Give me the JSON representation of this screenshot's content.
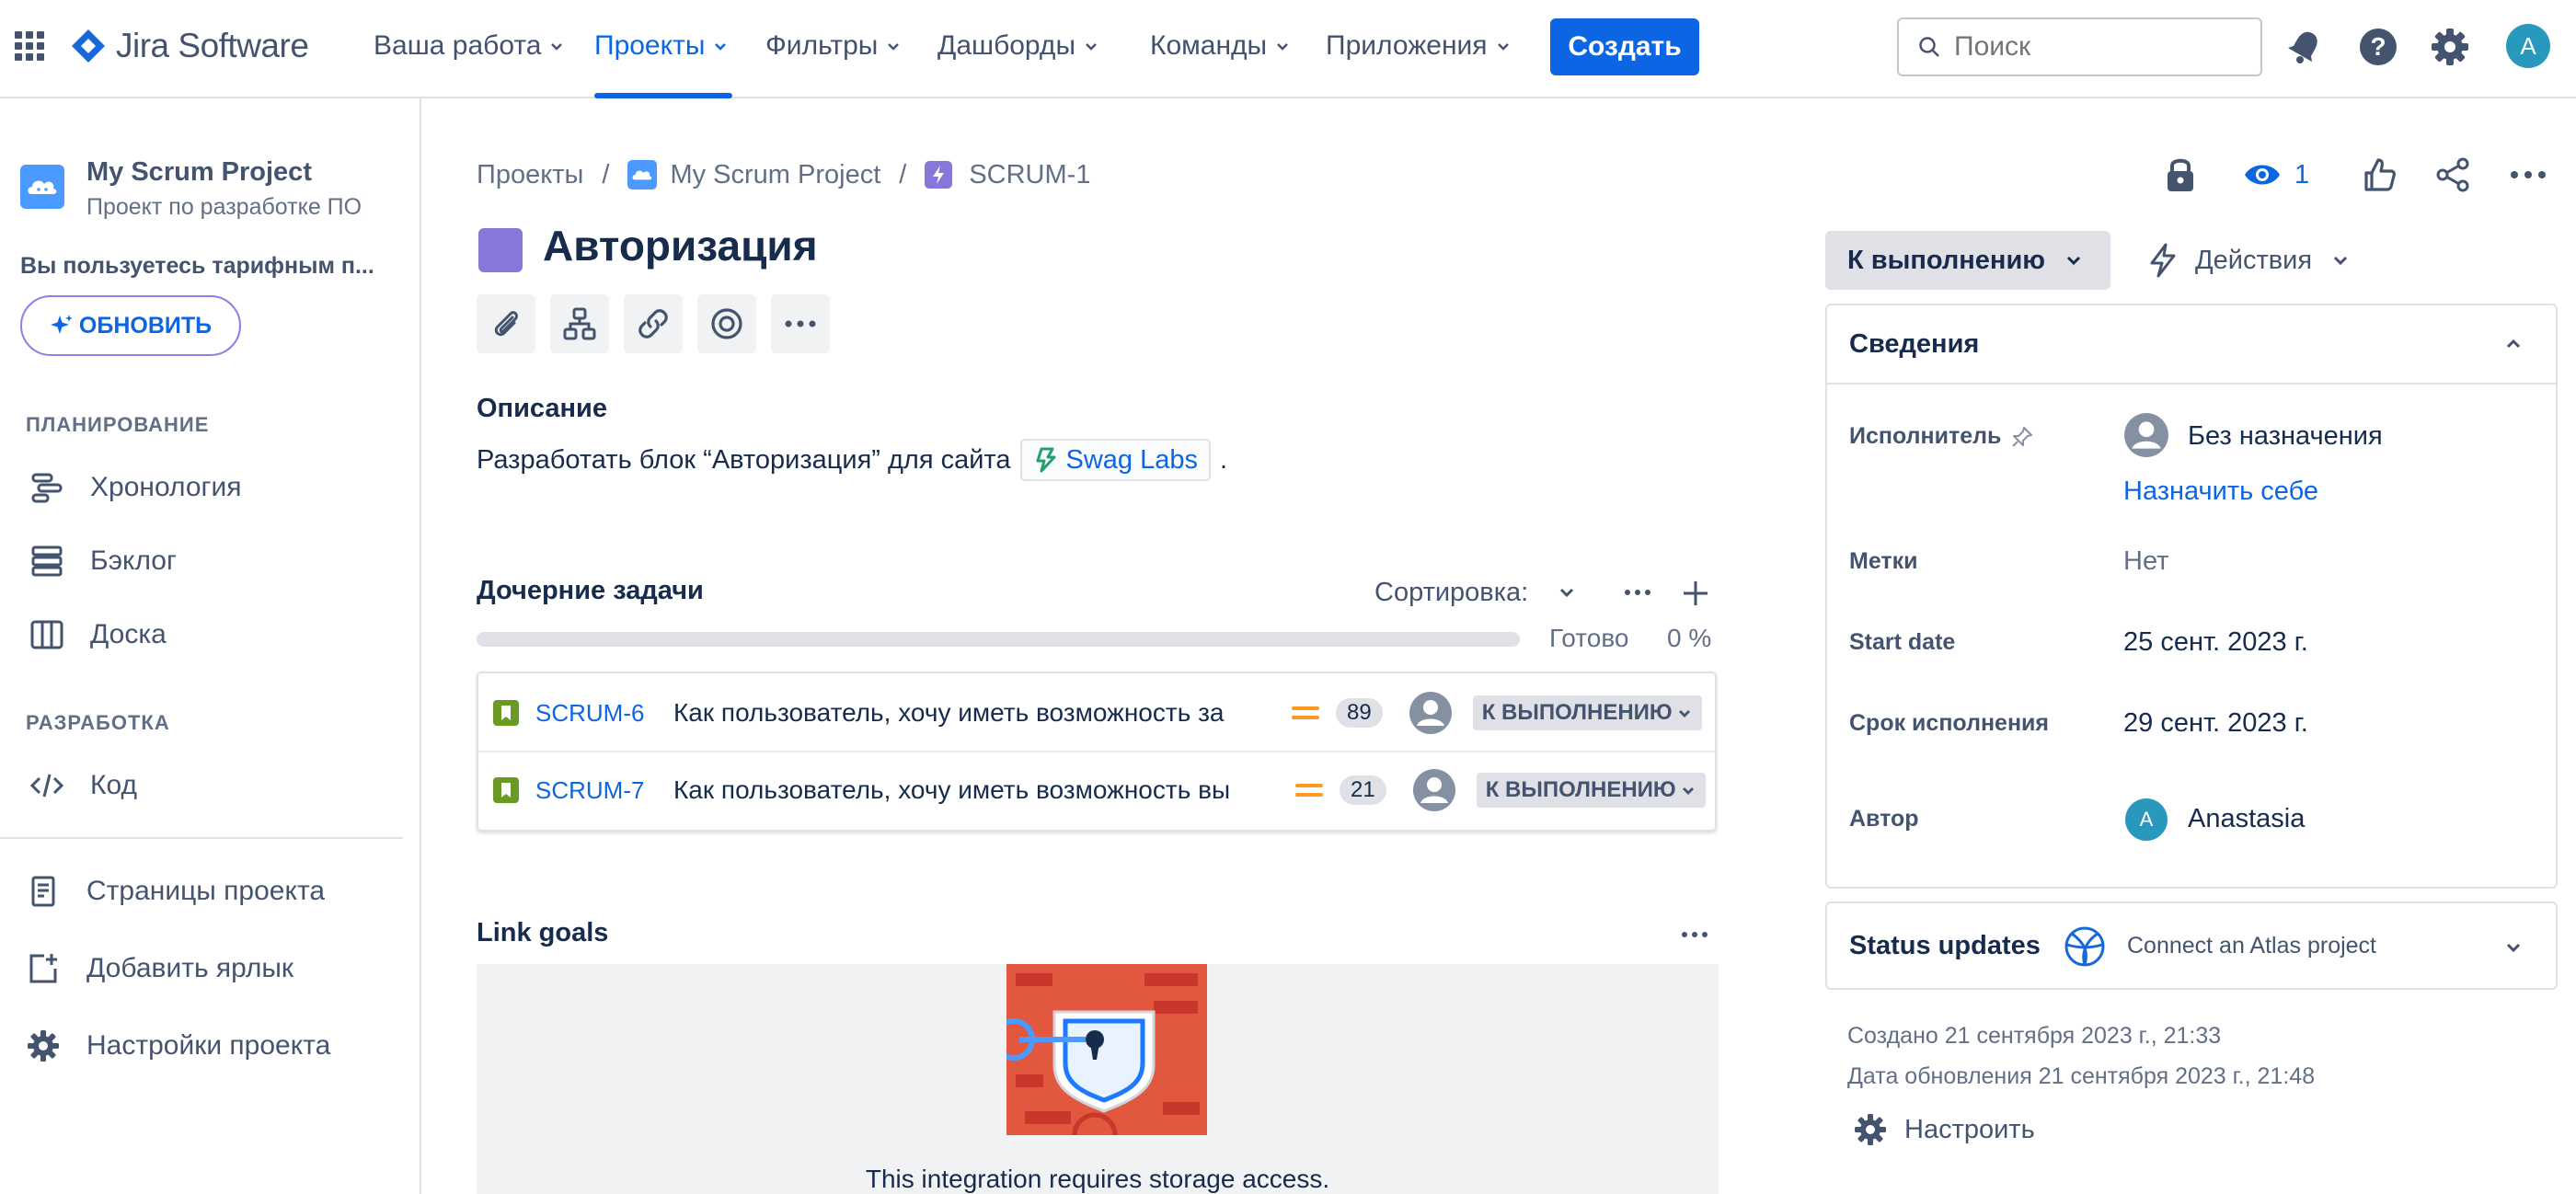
{
  "nav": {
    "product": "Jira Software",
    "items": [
      "Ваша работа",
      "Проекты",
      "Фильтры",
      "Дашборды",
      "Команды",
      "Приложения"
    ],
    "create": "Создать",
    "search_placeholder": "Поиск",
    "avatar": "A"
  },
  "sidebar": {
    "project_name": "My Scrum Project",
    "project_sub": "Проект по разработке ПО",
    "plan_note": "Вы пользуетесь тарифным п...",
    "upgrade": "ОБНОВИТЬ",
    "planning_heading": "ПЛАНИРОВАНИЕ",
    "planning": [
      "Хронология",
      "Бэклог",
      "Доска"
    ],
    "dev_heading": "РАЗРАБОТКА",
    "dev": [
      "Код"
    ],
    "bottom": [
      "Страницы проекта",
      "Добавить ярлык",
      "Настройки проекта"
    ]
  },
  "breadcrumb": {
    "projects": "Проекты",
    "project": "My Scrum Project",
    "issue": "SCRUM-1",
    "sep": "/"
  },
  "issue": {
    "title": "Авторизация",
    "description_label": "Описание",
    "description_text": "Разработать блок “Авторизация” для сайта",
    "link_text": "Swag Labs",
    "description_end": ".",
    "watchers": "1"
  },
  "children": {
    "title": "Дочерние задачи",
    "sort": "Сортировка:",
    "done_label": "Готово",
    "done_percent": "0 %",
    "progress": 0,
    "rows": [
      {
        "key": "SCRUM-6",
        "summary": "Как пользователь, хочу иметь возможность за",
        "points": "89",
        "status": "К ВЫПОЛНЕНИЮ"
      },
      {
        "key": "SCRUM-7",
        "summary": "Как пользователь, хочу иметь возможность вы",
        "points": "21",
        "status": "К ВЫПОЛНЕНИЮ"
      }
    ]
  },
  "goals": {
    "title": "Link goals",
    "message": "This integration requires storage access."
  },
  "panel": {
    "status_button": "К выполнению",
    "actions": "Действия",
    "details_title": "Сведения",
    "assignee_label": "Исполнитель",
    "assignee_value": "Без назначения",
    "assign_self": "Назначить себе",
    "labels_label": "Метки",
    "labels_value": "Нет",
    "start_label": "Start date",
    "start_value": "25 сент. 2023 г.",
    "due_label": "Срок исполнения",
    "due_value": "29 сент. 2023 г.",
    "author_label": "Автор",
    "author_value": "Anastasia",
    "author_initial": "A",
    "status_updates": "Status updates",
    "atlas": "Connect an Atlas project",
    "created": "Создано 21 сентября 2023 г., 21:33",
    "updated": "Дата обновления 21 сентября 2023 г., 21:48",
    "configure": "Настроить"
  },
  "colors": {
    "brand": "#0c66e4",
    "epic": "#8777d9",
    "story": "#6a9a23",
    "priority": "#ff991f"
  }
}
